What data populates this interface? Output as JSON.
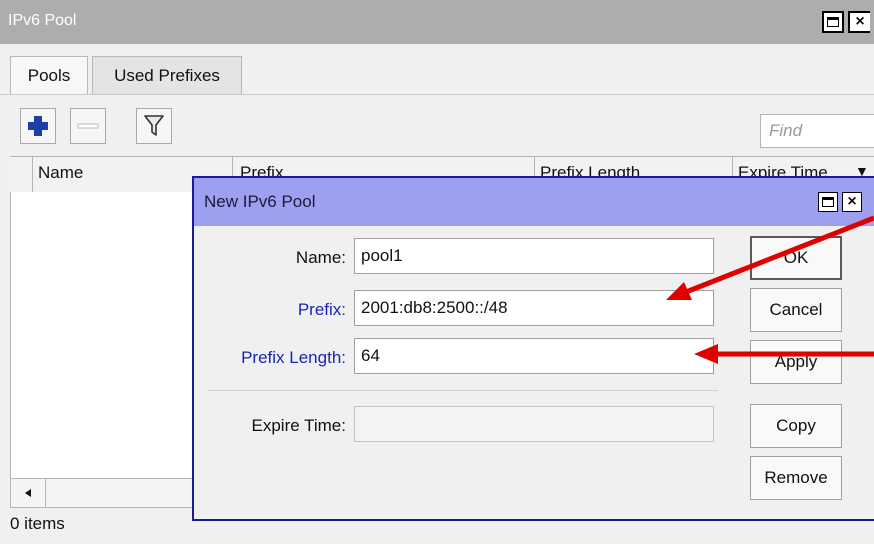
{
  "window": {
    "title": "IPv6 Pool"
  },
  "tabs": [
    {
      "label": "Pools"
    },
    {
      "label": "Used Prefixes"
    }
  ],
  "toolbar": {
    "find_placeholder": "Find"
  },
  "table": {
    "columns": [
      "Name",
      "Prefix",
      "Prefix Length",
      "Expire Time"
    ],
    "rows": []
  },
  "status": {
    "items": "0 items"
  },
  "dialog": {
    "title": "New IPv6 Pool",
    "fields": {
      "name": {
        "label": "Name:",
        "value": "pool1"
      },
      "prefix": {
        "label": "Prefix:",
        "value": "2001:db8:2500::/48"
      },
      "prefix_length": {
        "label": "Prefix Length:",
        "value": "64"
      },
      "expire_time": {
        "label": "Expire Time:",
        "value": ""
      }
    },
    "buttons": {
      "ok": "OK",
      "cancel": "Cancel",
      "apply": "Apply",
      "copy": "Copy",
      "remove": "Remove"
    }
  },
  "colors": {
    "dialog_title_bar": "#9d9ff0",
    "window_title_bar": "#adadad",
    "annotation_arrow": "#e00000",
    "field_label_blue": "#1a25b8"
  },
  "icons": [
    "add-icon",
    "remove-icon",
    "filter-icon",
    "restore-icon",
    "close-icon",
    "scroll-left-icon",
    "sort-dropdown-icon"
  ]
}
